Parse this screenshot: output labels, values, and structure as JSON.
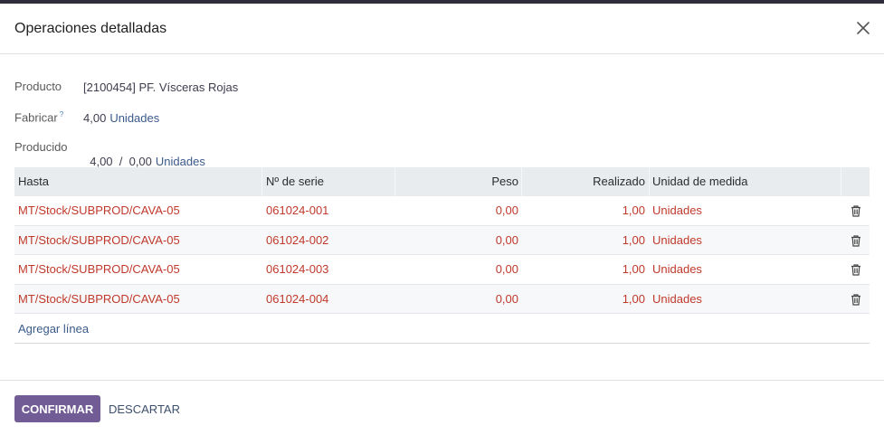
{
  "dialog": {
    "title": "Operaciones detalladas"
  },
  "fields": {
    "producto": {
      "label": "Producto",
      "value": "[2100454] PF. Vísceras Rojas"
    },
    "fabricar": {
      "label": "Fabricar",
      "help": "?",
      "qty": "4,00",
      "uom": "Unidades"
    },
    "producido": {
      "label": "Producido",
      "qty": "4,00  /  0,00",
      "uom": "Unidades"
    }
  },
  "table": {
    "headers": {
      "hasta": "Hasta",
      "serie": "Nº de serie",
      "peso": "Peso",
      "realizado": "Realizado",
      "uom": "Unidad de medida"
    },
    "rows": [
      {
        "hasta": "MT/Stock/SUBPROD/CAVA-05",
        "serie": "061024-001",
        "peso": "0,00",
        "realizado": "1,00",
        "uom": "Unidades"
      },
      {
        "hasta": "MT/Stock/SUBPROD/CAVA-05",
        "serie": "061024-002",
        "peso": "0,00",
        "realizado": "1,00",
        "uom": "Unidades"
      },
      {
        "hasta": "MT/Stock/SUBPROD/CAVA-05",
        "serie": "061024-003",
        "peso": "0,00",
        "realizado": "1,00",
        "uom": "Unidades"
      },
      {
        "hasta": "MT/Stock/SUBPROD/CAVA-05",
        "serie": "061024-004",
        "peso": "0,00",
        "realizado": "1,00",
        "uom": "Unidades"
      }
    ],
    "add_line": "Agregar línea"
  },
  "footer": {
    "confirm_label": "CONFIRMAR",
    "discard_label": "DESCARTAR"
  },
  "icons": {
    "close": "close-icon",
    "trash": "trash-icon"
  },
  "colors": {
    "primary": "#715c96",
    "line_text": "#c0392b",
    "link": "#3a5a8a",
    "header_bg": "#e9ecef"
  }
}
